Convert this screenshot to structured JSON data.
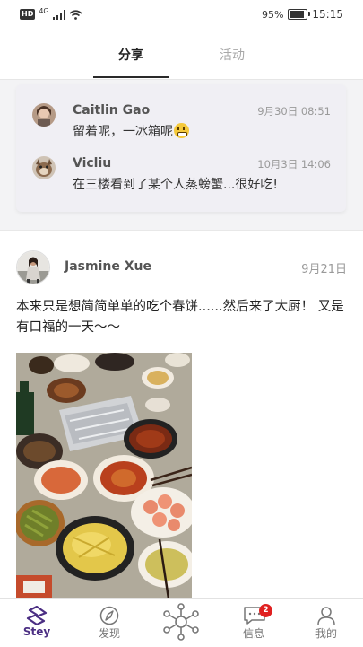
{
  "status_bar": {
    "left_badge": "HD",
    "network": "4G",
    "battery_text": "95%",
    "battery_level": 0.95,
    "time": "15:15"
  },
  "tabs": [
    {
      "label": "分享",
      "active": true
    },
    {
      "label": "活动",
      "active": false
    }
  ],
  "comments": [
    {
      "name": "Caitlin Gao",
      "time": "9月30日 08:51",
      "text": "留着呢，一冰箱呢",
      "emoji": "grimacing-face"
    },
    {
      "name": "Vicliu",
      "time": "10月3日 14:06",
      "text": "在三楼看到了某个人蒸螃蟹...很好吃!"
    }
  ],
  "post": {
    "author": "Jasmine Xue",
    "date": "9月21日",
    "text": "本来只是想简简单单的吃个春饼......然后来了大厨！ 又是有口福的一天～～"
  },
  "bottom_nav": [
    {
      "label": "Stey",
      "icon": "stey-logo-icon",
      "active": true
    },
    {
      "label": "发现",
      "icon": "compass-icon"
    },
    {
      "label": "",
      "icon": "hub-network-icon"
    },
    {
      "label": "信息",
      "icon": "message-icon",
      "badge": "2"
    },
    {
      "label": "我的",
      "icon": "profile-icon"
    }
  ],
  "colors": {
    "accent": "#4b2e83",
    "badge": "#e02020",
    "card_bg": "#f0eff4"
  }
}
